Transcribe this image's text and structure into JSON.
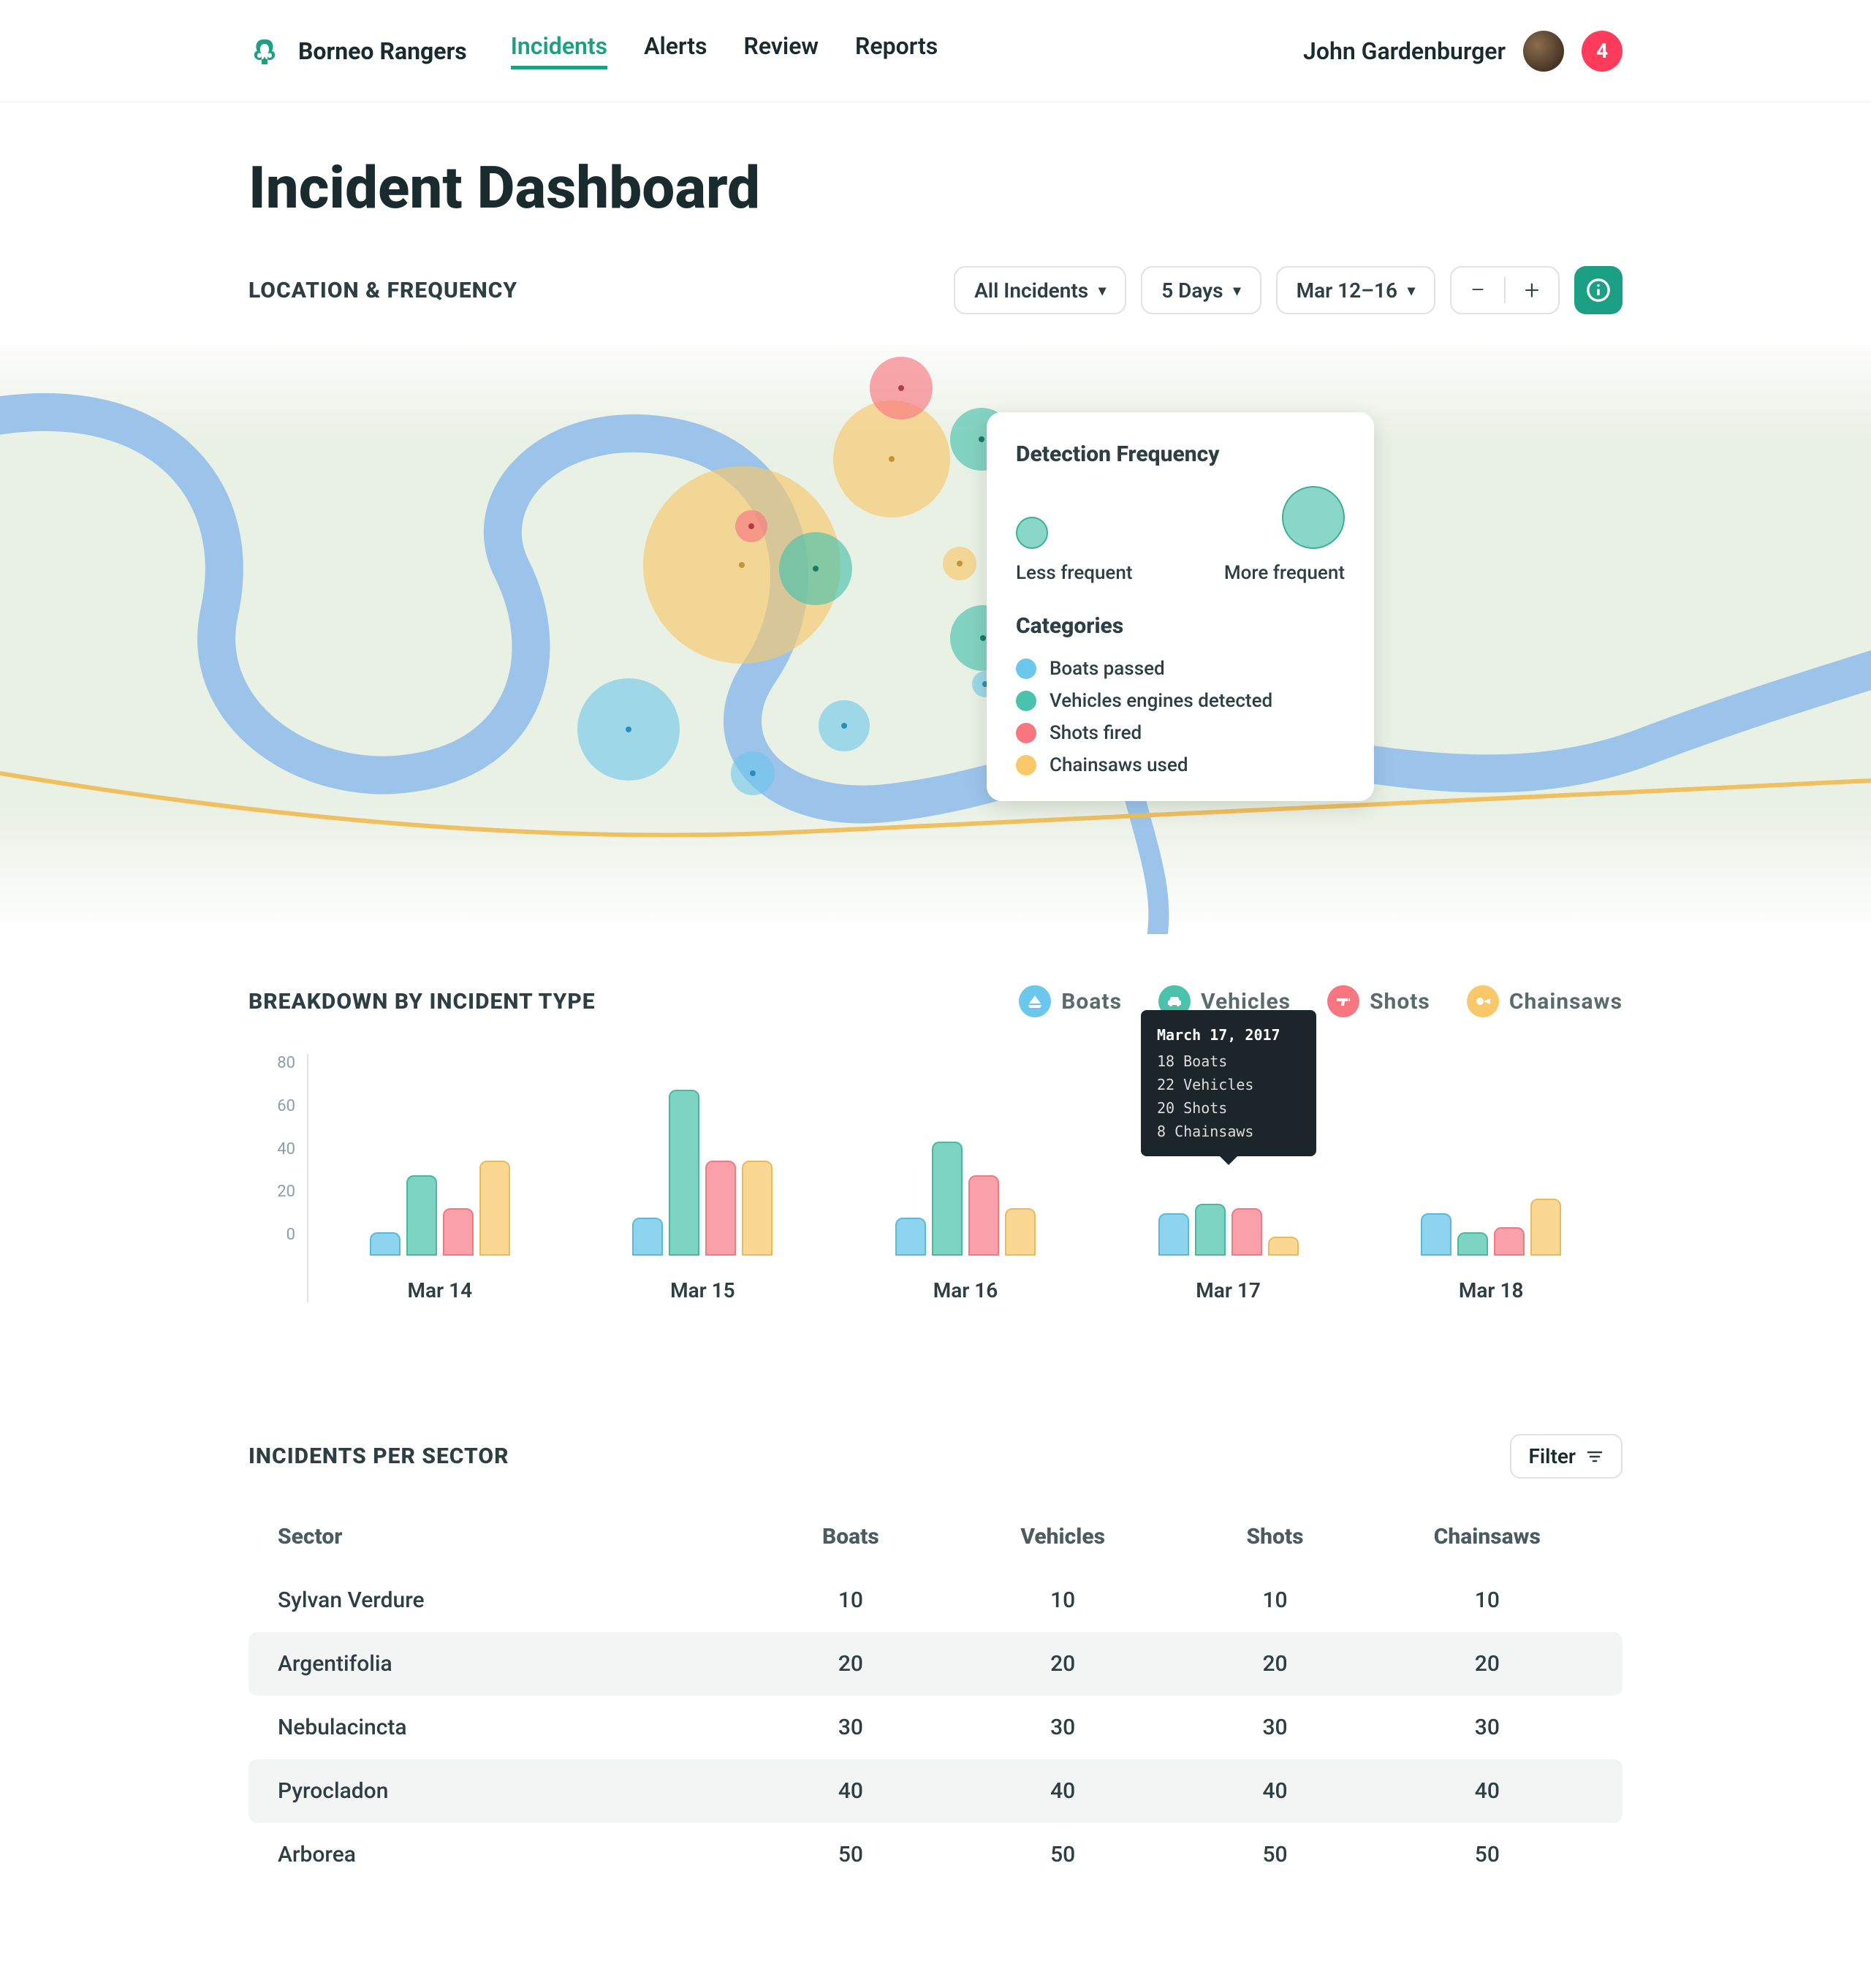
{
  "header": {
    "brand": "Borneo Rangers",
    "nav": [
      "Incidents",
      "Alerts",
      "Review",
      "Reports"
    ],
    "active_nav": "Incidents",
    "user_name": "John Gardenburger",
    "badge": "4"
  },
  "page_title": "Incident Dashboard",
  "map": {
    "section_title": "LOCATION & FREQUENCY",
    "filter_incidents": "All Incidents",
    "filter_days": "5 Days",
    "filter_range": "Mar 12–16",
    "legend": {
      "title": "Detection Frequency",
      "less": "Less frequent",
      "more": "More frequent",
      "categories_title": "Categories",
      "categories": [
        {
          "color": "blue",
          "label": "Boats passed"
        },
        {
          "color": "green",
          "label": "Vehicles engines detected"
        },
        {
          "color": "red",
          "label": "Shots fired"
        },
        {
          "color": "orange",
          "label": "Chainsaws used"
        }
      ]
    }
  },
  "breakdown": {
    "section_title": "BREAKDOWN BY INCIDENT TYPE",
    "types": [
      "Boats",
      "Vehicles",
      "Shots",
      "Chainsaws"
    ],
    "tooltip": {
      "date": "March 17, 2017",
      "lines": [
        "18 Boats",
        "22 Vehicles",
        "20 Shots",
        "8 Chainsaws"
      ]
    }
  },
  "chart_data": {
    "type": "bar",
    "categories": [
      "Mar 14",
      "Mar 15",
      "Mar 16",
      "Mar 17",
      "Mar 18"
    ],
    "series": [
      {
        "name": "Boats",
        "values": [
          10,
          16,
          16,
          18,
          18
        ]
      },
      {
        "name": "Vehicles",
        "values": [
          34,
          70,
          48,
          22,
          10
        ]
      },
      {
        "name": "Shots",
        "values": [
          20,
          40,
          34,
          20,
          12
        ]
      },
      {
        "name": "Chainsaws",
        "values": [
          40,
          40,
          20,
          8,
          24
        ]
      }
    ],
    "ylim": [
      0,
      80
    ],
    "yticks": [
      80,
      60,
      40,
      20,
      0
    ],
    "xlabel": "",
    "ylabel": ""
  },
  "sectors": {
    "section_title": "INCIDENTS PER SECTOR",
    "filter_label": "Filter",
    "columns": [
      "Sector",
      "Boats",
      "Vehicles",
      "Shots",
      "Chainsaws"
    ],
    "rows": [
      {
        "sector": "Sylvan Verdure",
        "boats": "10",
        "vehicles": "10",
        "shots": "10",
        "chainsaws": "10"
      },
      {
        "sector": "Argentifolia",
        "boats": "20",
        "vehicles": "20",
        "shots": "20",
        "chainsaws": "20"
      },
      {
        "sector": "Nebulacincta",
        "boats": "30",
        "vehicles": "30",
        "shots": "30",
        "chainsaws": "30"
      },
      {
        "sector": "Pyrocladon",
        "boats": "40",
        "vehicles": "40",
        "shots": "40",
        "chainsaws": "40"
      },
      {
        "sector": "Arborea",
        "boats": "50",
        "vehicles": "50",
        "shots": "50",
        "chainsaws": "50"
      }
    ]
  }
}
